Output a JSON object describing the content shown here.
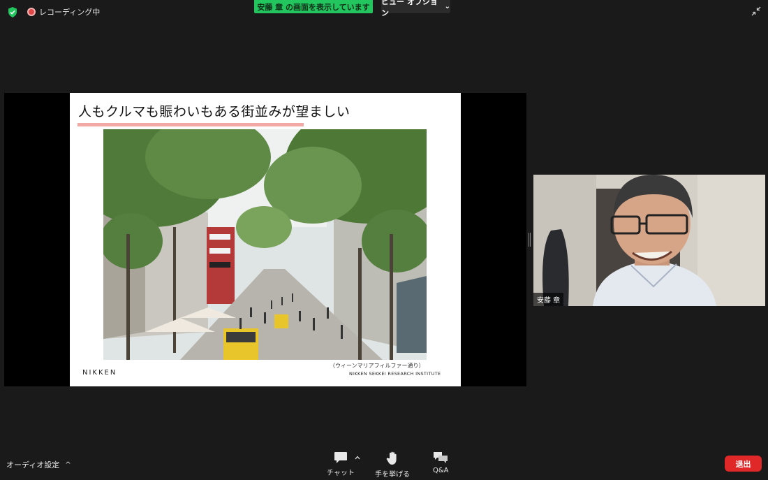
{
  "topbar": {
    "recording_label": "レコーディング中",
    "share_banner": "安藤 章 の画面を表示しています",
    "view_options": "ビュー オプション",
    "view_options_chevron": "⌄"
  },
  "slide": {
    "title": "人もクルマも賑わいもある街並みが望ましい",
    "caption": "（ウィーンマリアフィルファー通り）",
    "institute": "NIKKEN SEKKEI RESEARCH INSTITUTE",
    "brand": "NIKKEN"
  },
  "video": {
    "participant_name": "安藤 章"
  },
  "bottombar": {
    "audio_settings": "オーディオ設定",
    "audio_caret": "^",
    "chat": "チャット",
    "raise_hand": "手を挙げる",
    "qa": "Q&A",
    "exit": "退出"
  },
  "colors": {
    "share_banner": "#23c55e",
    "exit_button": "#e02828",
    "recording": "#e04848",
    "slide_underline": "#f2a9a6"
  }
}
